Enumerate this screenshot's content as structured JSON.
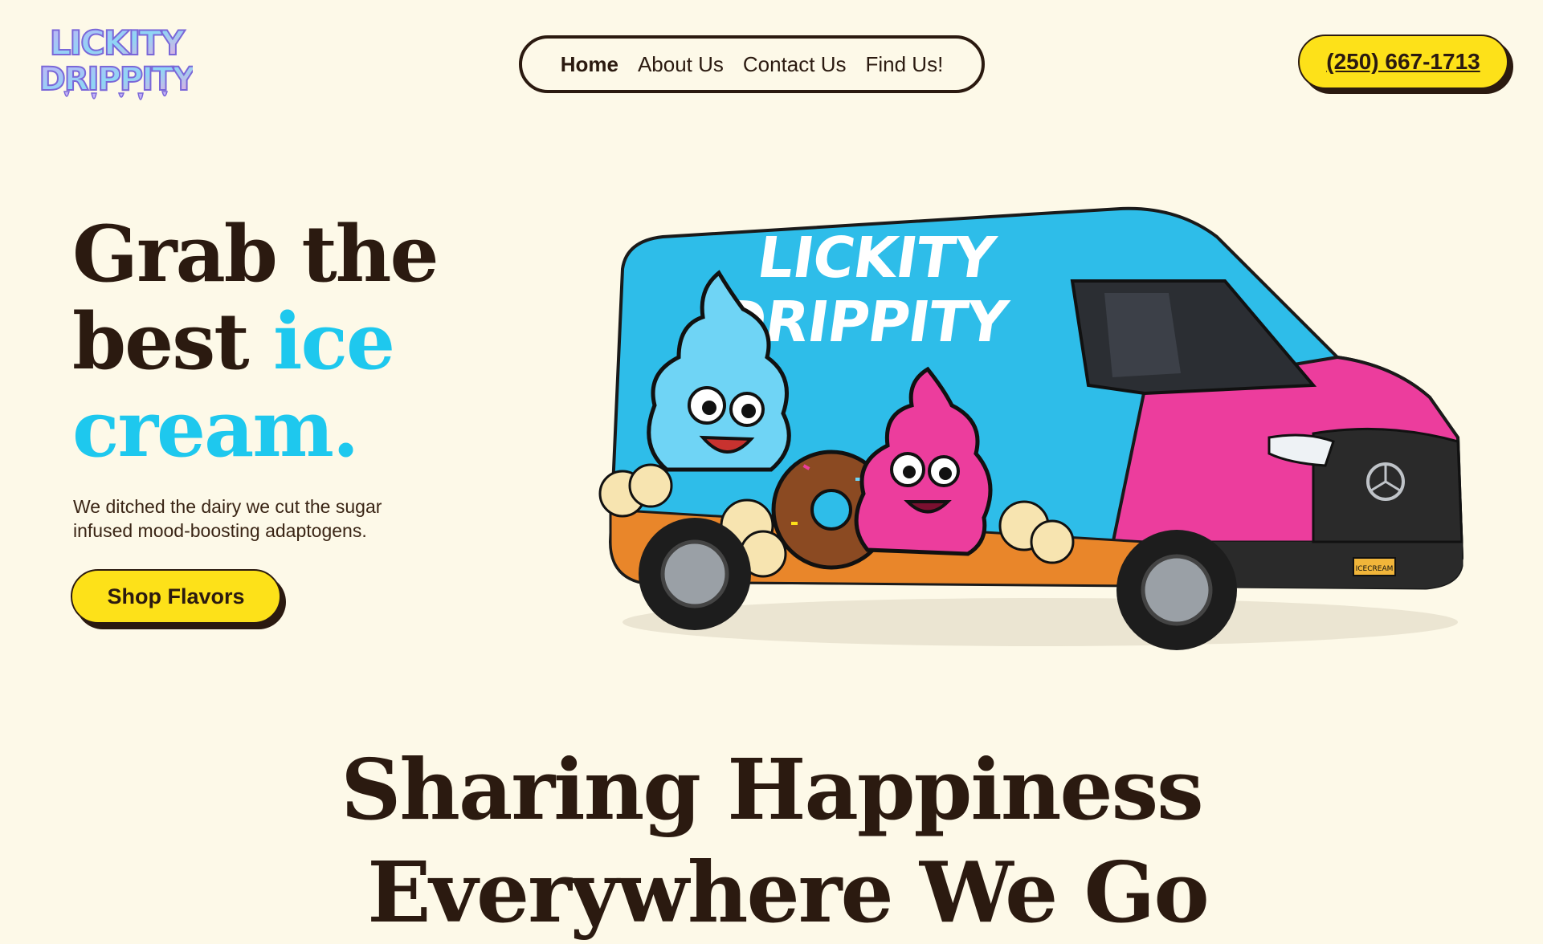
{
  "brand": {
    "logo_line1": "LICKITY",
    "logo_line2": "DRIPPITY",
    "logo_colors": [
      "#b9a7f5",
      "#8ed6f5",
      "#f3a4dc"
    ]
  },
  "nav": {
    "items": [
      {
        "label": "Home",
        "active": true
      },
      {
        "label": "About Us",
        "active": false
      },
      {
        "label": "Contact Us",
        "active": false
      },
      {
        "label": "Find Us!",
        "active": false
      }
    ],
    "phone": "(250) 667-1713"
  },
  "hero": {
    "title_part1": "Grab the best ",
    "title_accent": "ice cream.",
    "subtitle": "We ditched the dairy we cut the sugar infused mood-boosting adaptogens.",
    "cta_label": "Shop Flavors",
    "van_brand_line1": "LICKITY",
    "van_brand_line2": "DRIPPITY",
    "van_plate": "ICECREAM"
  },
  "section": {
    "title_line1": "Sharing Happiness",
    "title_line2": "Everywhere We Go"
  },
  "colors": {
    "background": "#fdf9e8",
    "text": "#2b1a10",
    "accent": "#1ec8ee",
    "button": "#fde119",
    "van_blue": "#2ebde9",
    "van_pink": "#ec3d9d"
  }
}
